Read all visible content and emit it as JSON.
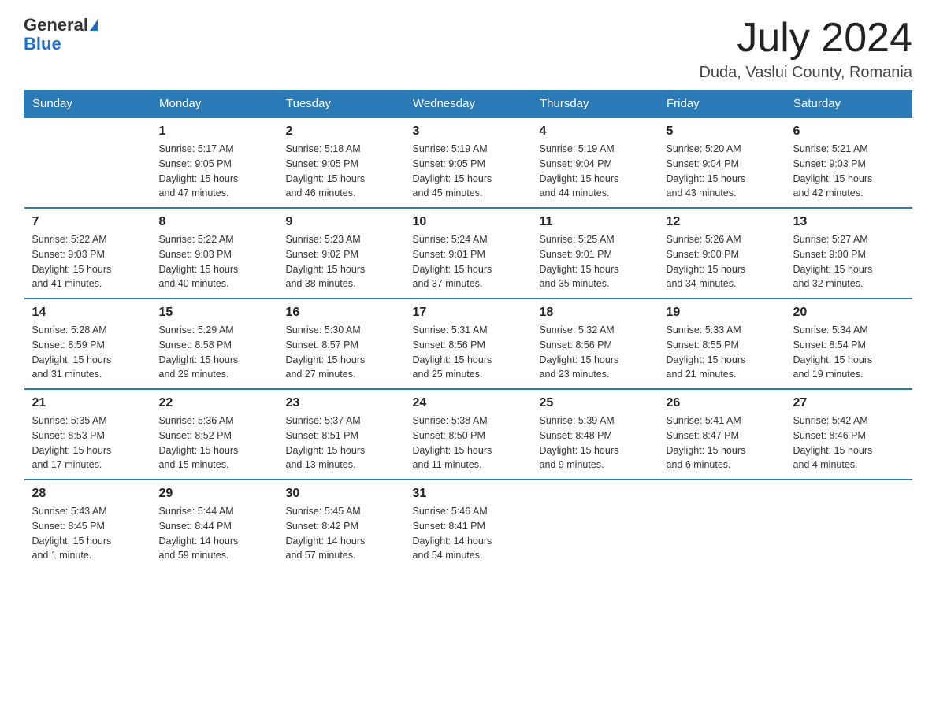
{
  "header": {
    "logo_general": "General",
    "logo_blue": "Blue",
    "month_title": "July 2024",
    "location": "Duda, Vaslui County, Romania"
  },
  "days_of_week": [
    "Sunday",
    "Monday",
    "Tuesday",
    "Wednesday",
    "Thursday",
    "Friday",
    "Saturday"
  ],
  "weeks": [
    [
      {
        "day": "",
        "info": ""
      },
      {
        "day": "1",
        "info": "Sunrise: 5:17 AM\nSunset: 9:05 PM\nDaylight: 15 hours\nand 47 minutes."
      },
      {
        "day": "2",
        "info": "Sunrise: 5:18 AM\nSunset: 9:05 PM\nDaylight: 15 hours\nand 46 minutes."
      },
      {
        "day": "3",
        "info": "Sunrise: 5:19 AM\nSunset: 9:05 PM\nDaylight: 15 hours\nand 45 minutes."
      },
      {
        "day": "4",
        "info": "Sunrise: 5:19 AM\nSunset: 9:04 PM\nDaylight: 15 hours\nand 44 minutes."
      },
      {
        "day": "5",
        "info": "Sunrise: 5:20 AM\nSunset: 9:04 PM\nDaylight: 15 hours\nand 43 minutes."
      },
      {
        "day": "6",
        "info": "Sunrise: 5:21 AM\nSunset: 9:03 PM\nDaylight: 15 hours\nand 42 minutes."
      }
    ],
    [
      {
        "day": "7",
        "info": "Sunrise: 5:22 AM\nSunset: 9:03 PM\nDaylight: 15 hours\nand 41 minutes."
      },
      {
        "day": "8",
        "info": "Sunrise: 5:22 AM\nSunset: 9:03 PM\nDaylight: 15 hours\nand 40 minutes."
      },
      {
        "day": "9",
        "info": "Sunrise: 5:23 AM\nSunset: 9:02 PM\nDaylight: 15 hours\nand 38 minutes."
      },
      {
        "day": "10",
        "info": "Sunrise: 5:24 AM\nSunset: 9:01 PM\nDaylight: 15 hours\nand 37 minutes."
      },
      {
        "day": "11",
        "info": "Sunrise: 5:25 AM\nSunset: 9:01 PM\nDaylight: 15 hours\nand 35 minutes."
      },
      {
        "day": "12",
        "info": "Sunrise: 5:26 AM\nSunset: 9:00 PM\nDaylight: 15 hours\nand 34 minutes."
      },
      {
        "day": "13",
        "info": "Sunrise: 5:27 AM\nSunset: 9:00 PM\nDaylight: 15 hours\nand 32 minutes."
      }
    ],
    [
      {
        "day": "14",
        "info": "Sunrise: 5:28 AM\nSunset: 8:59 PM\nDaylight: 15 hours\nand 31 minutes."
      },
      {
        "day": "15",
        "info": "Sunrise: 5:29 AM\nSunset: 8:58 PM\nDaylight: 15 hours\nand 29 minutes."
      },
      {
        "day": "16",
        "info": "Sunrise: 5:30 AM\nSunset: 8:57 PM\nDaylight: 15 hours\nand 27 minutes."
      },
      {
        "day": "17",
        "info": "Sunrise: 5:31 AM\nSunset: 8:56 PM\nDaylight: 15 hours\nand 25 minutes."
      },
      {
        "day": "18",
        "info": "Sunrise: 5:32 AM\nSunset: 8:56 PM\nDaylight: 15 hours\nand 23 minutes."
      },
      {
        "day": "19",
        "info": "Sunrise: 5:33 AM\nSunset: 8:55 PM\nDaylight: 15 hours\nand 21 minutes."
      },
      {
        "day": "20",
        "info": "Sunrise: 5:34 AM\nSunset: 8:54 PM\nDaylight: 15 hours\nand 19 minutes."
      }
    ],
    [
      {
        "day": "21",
        "info": "Sunrise: 5:35 AM\nSunset: 8:53 PM\nDaylight: 15 hours\nand 17 minutes."
      },
      {
        "day": "22",
        "info": "Sunrise: 5:36 AM\nSunset: 8:52 PM\nDaylight: 15 hours\nand 15 minutes."
      },
      {
        "day": "23",
        "info": "Sunrise: 5:37 AM\nSunset: 8:51 PM\nDaylight: 15 hours\nand 13 minutes."
      },
      {
        "day": "24",
        "info": "Sunrise: 5:38 AM\nSunset: 8:50 PM\nDaylight: 15 hours\nand 11 minutes."
      },
      {
        "day": "25",
        "info": "Sunrise: 5:39 AM\nSunset: 8:48 PM\nDaylight: 15 hours\nand 9 minutes."
      },
      {
        "day": "26",
        "info": "Sunrise: 5:41 AM\nSunset: 8:47 PM\nDaylight: 15 hours\nand 6 minutes."
      },
      {
        "day": "27",
        "info": "Sunrise: 5:42 AM\nSunset: 8:46 PM\nDaylight: 15 hours\nand 4 minutes."
      }
    ],
    [
      {
        "day": "28",
        "info": "Sunrise: 5:43 AM\nSunset: 8:45 PM\nDaylight: 15 hours\nand 1 minute."
      },
      {
        "day": "29",
        "info": "Sunrise: 5:44 AM\nSunset: 8:44 PM\nDaylight: 14 hours\nand 59 minutes."
      },
      {
        "day": "30",
        "info": "Sunrise: 5:45 AM\nSunset: 8:42 PM\nDaylight: 14 hours\nand 57 minutes."
      },
      {
        "day": "31",
        "info": "Sunrise: 5:46 AM\nSunset: 8:41 PM\nDaylight: 14 hours\nand 54 minutes."
      },
      {
        "day": "",
        "info": ""
      },
      {
        "day": "",
        "info": ""
      },
      {
        "day": "",
        "info": ""
      }
    ]
  ]
}
